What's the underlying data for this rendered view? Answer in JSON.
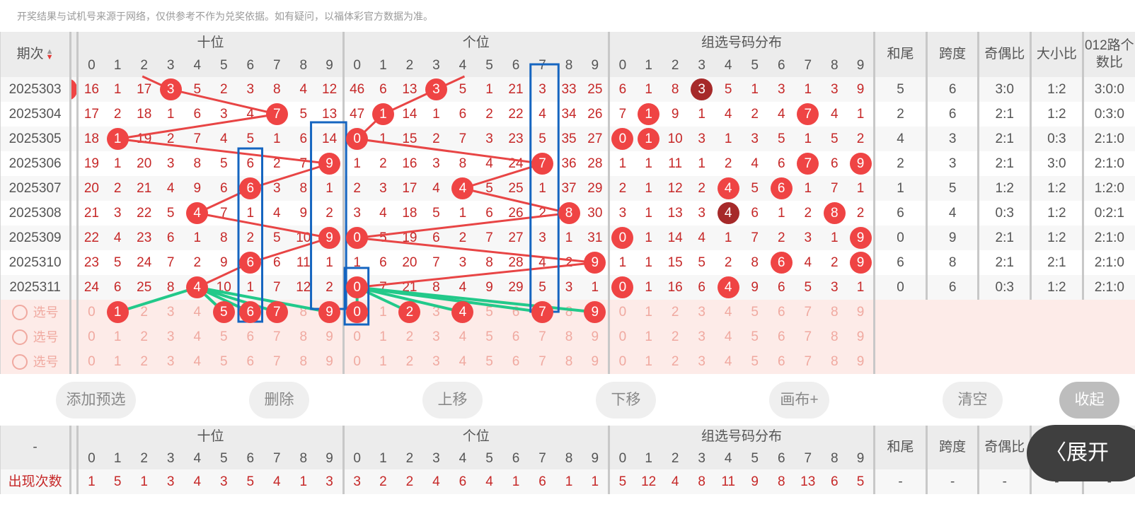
{
  "notice": "开奖结果与试机号来源于网络，仅供参考不作为兑奖依据。如有疑问，以福体彩官方数据为准。",
  "header": {
    "period_label": "期次",
    "sort_up": "▲",
    "sort_down": "▼",
    "groups": [
      "十位",
      "个位",
      "组选号码分布"
    ],
    "digits": [
      "0",
      "1",
      "2",
      "3",
      "4",
      "5",
      "6",
      "7",
      "8",
      "9"
    ],
    "extra_cols": [
      "和尾",
      "跨度",
      "奇偶比",
      "大小比",
      "012路个数比"
    ]
  },
  "rows": [
    {
      "period": "2025303",
      "tens": [
        "16",
        "1",
        "17",
        "3",
        "5",
        "2",
        "3",
        "8",
        "4",
        "12"
      ],
      "ones": [
        "46",
        "6",
        "13",
        "3",
        "5",
        "1",
        "21",
        "3",
        "33",
        "25"
      ],
      "group": [
        "6",
        "1",
        "8",
        "3",
        "5",
        "1",
        "3",
        "1",
        "3",
        "9"
      ],
      "hw": "5",
      "kd": "6",
      "jo": "3:0",
      "dx": "1:2",
      "lu": "3:0:0"
    },
    {
      "period": "2025304",
      "tens": [
        "17",
        "2",
        "18",
        "1",
        "6",
        "3",
        "4",
        "7",
        "5",
        "13"
      ],
      "ones": [
        "47",
        "1",
        "14",
        "1",
        "6",
        "2",
        "22",
        "4",
        "34",
        "26"
      ],
      "group": [
        "7",
        "1",
        "9",
        "1",
        "4",
        "2",
        "4",
        "7",
        "4",
        "1"
      ],
      "hw": "2",
      "kd": "6",
      "jo": "2:1",
      "dx": "1:2",
      "lu": "0:3:0"
    },
    {
      "period": "2025305",
      "tens": [
        "18",
        "1",
        "19",
        "2",
        "7",
        "4",
        "5",
        "1",
        "6",
        "14"
      ],
      "ones": [
        "0",
        "1",
        "15",
        "2",
        "7",
        "3",
        "23",
        "5",
        "35",
        "27"
      ],
      "group": [
        "0",
        "1",
        "10",
        "3",
        "1",
        "3",
        "5",
        "1",
        "5",
        "2"
      ],
      "hw": "4",
      "kd": "3",
      "jo": "2:1",
      "dx": "0:3",
      "lu": "2:1:0"
    },
    {
      "period": "2025306",
      "tens": [
        "19",
        "1",
        "20",
        "3",
        "8",
        "5",
        "6",
        "2",
        "7",
        "9"
      ],
      "ones": [
        "1",
        "2",
        "16",
        "3",
        "8",
        "4",
        "24",
        "7",
        "36",
        "28"
      ],
      "group": [
        "1",
        "1",
        "11",
        "1",
        "2",
        "4",
        "6",
        "7",
        "6",
        "9"
      ],
      "hw": "2",
      "kd": "3",
      "jo": "2:1",
      "dx": "3:0",
      "lu": "2:1:0"
    },
    {
      "period": "2025307",
      "tens": [
        "20",
        "2",
        "21",
        "4",
        "9",
        "6",
        "6",
        "3",
        "8",
        "1"
      ],
      "ones": [
        "2",
        "3",
        "17",
        "4",
        "4",
        "5",
        "25",
        "1",
        "37",
        "29"
      ],
      "group": [
        "2",
        "1",
        "12",
        "2",
        "4",
        "5",
        "6",
        "1",
        "7",
        "1"
      ],
      "hw": "1",
      "kd": "5",
      "jo": "1:2",
      "dx": "1:2",
      "lu": "1:2:0"
    },
    {
      "period": "2025308",
      "tens": [
        "21",
        "3",
        "22",
        "5",
        "4",
        "7",
        "1",
        "4",
        "9",
        "2"
      ],
      "ones": [
        "3",
        "4",
        "18",
        "5",
        "1",
        "6",
        "26",
        "2",
        "8",
        "30"
      ],
      "group": [
        "3",
        "1",
        "13",
        "3",
        "4",
        "6",
        "1",
        "2",
        "8",
        "2"
      ],
      "hw": "6",
      "kd": "4",
      "jo": "0:3",
      "dx": "1:2",
      "lu": "0:2:1"
    },
    {
      "period": "2025309",
      "tens": [
        "22",
        "4",
        "23",
        "6",
        "1",
        "8",
        "2",
        "5",
        "10",
        "9"
      ],
      "ones": [
        "0",
        "5",
        "19",
        "6",
        "2",
        "7",
        "27",
        "3",
        "1",
        "31"
      ],
      "group": [
        "0",
        "1",
        "14",
        "4",
        "1",
        "7",
        "2",
        "3",
        "1",
        "9"
      ],
      "hw": "0",
      "kd": "9",
      "jo": "2:1",
      "dx": "1:2",
      "lu": "2:1:0"
    },
    {
      "period": "2025310",
      "tens": [
        "23",
        "5",
        "24",
        "7",
        "2",
        "9",
        "6",
        "6",
        "11",
        "1"
      ],
      "ones": [
        "1",
        "6",
        "20",
        "7",
        "3",
        "8",
        "28",
        "4",
        "2",
        "9"
      ],
      "group": [
        "1",
        "1",
        "15",
        "5",
        "2",
        "8",
        "6",
        "4",
        "2",
        "9"
      ],
      "hw": "6",
      "kd": "8",
      "jo": "2:1",
      "dx": "2:1",
      "lu": "2:1:0"
    },
    {
      "period": "2025311",
      "tens": [
        "24",
        "6",
        "25",
        "8",
        "4",
        "10",
        "1",
        "7",
        "12",
        "2"
      ],
      "ones": [
        "0",
        "7",
        "21",
        "8",
        "4",
        "9",
        "29",
        "5",
        "3",
        "1"
      ],
      "group": [
        "0",
        "1",
        "16",
        "6",
        "4",
        "9",
        "6",
        "5",
        "3",
        "1"
      ],
      "hw": "0",
      "kd": "6",
      "jo": "0:3",
      "dx": "1:2",
      "lu": "2:1:0"
    }
  ],
  "select_label": "选号",
  "buttons": {
    "add": "添加预选",
    "delete": "删除",
    "up": "上移",
    "down": "下移",
    "canvas": "画布+",
    "clear": "清空",
    "collapse": "收起"
  },
  "bottom": {
    "period_placeholder": "-",
    "count_label": "出现次数",
    "tens": [
      "1",
      "5",
      "1",
      "3",
      "4",
      "3",
      "5",
      "4",
      "1",
      "3"
    ],
    "ones": [
      "3",
      "2",
      "2",
      "4",
      "6",
      "4",
      "1",
      "6",
      "1",
      "1"
    ],
    "group": [
      "5",
      "12",
      "4",
      "8",
      "11",
      "9",
      "8",
      "13",
      "6",
      "5"
    ],
    "extra": [
      "-",
      "-",
      "-",
      "-",
      "-"
    ]
  },
  "expand_button": "展开",
  "colors": {
    "ball": "#ef4444",
    "ball_dark": "#a62a2a",
    "trend_line": "#e84545",
    "pick_line": "#22c98a",
    "box": "#1565c0",
    "select_bg": "#fdebe8"
  }
}
